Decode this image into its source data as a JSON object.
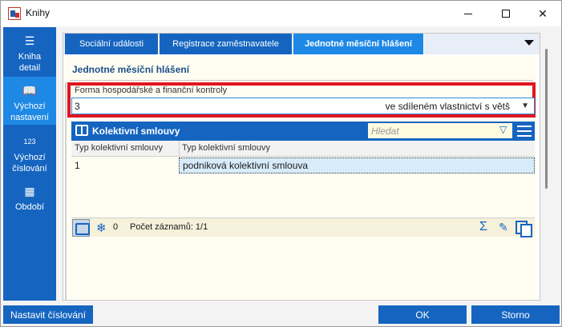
{
  "window": {
    "title": "Knihy"
  },
  "sidebar": {
    "items": [
      {
        "label_1": "Kniha",
        "label_2": "detail",
        "icon": "menu-icon"
      },
      {
        "label_1": "Výchozí",
        "label_2": "nastavení",
        "icon": "book-open-icon"
      },
      {
        "label_1": "Výchozí",
        "label_2": "číslování",
        "icon": "numbering-icon",
        "icon_text": "123"
      },
      {
        "label_1": "Období",
        "label_2": "",
        "icon": "calendar-icon"
      }
    ]
  },
  "tabs": [
    {
      "label": "Sociální události"
    },
    {
      "label": "Registrace zaměstnavatele"
    },
    {
      "label": "Jednotné měsíční hlášení"
    }
  ],
  "section": {
    "title": "Jednotné měsíční hlášení",
    "field_label": "Forma hospodářské a finanční kontroly",
    "field_code": "3",
    "field_text": "ve sdíleném vlastnictví s větš"
  },
  "grid": {
    "title": "Kolektivní smlouvy",
    "search_placeholder": "Hledat",
    "columns": [
      "Typ kolektivní smlouvy",
      "Typ kolektivní smlouvy"
    ],
    "rows": [
      {
        "code": "1",
        "name": "podniková kolektivní smlouva"
      }
    ],
    "footer_zero": "0",
    "footer_count": "Počet záznamů: 1/1"
  },
  "buttons": {
    "numbering": "Nastavit číslování",
    "ok": "OK",
    "cancel": "Storno"
  },
  "colors": {
    "primary": "#1565c0",
    "active": "#1e88e5",
    "highlight": "#e0161e"
  }
}
